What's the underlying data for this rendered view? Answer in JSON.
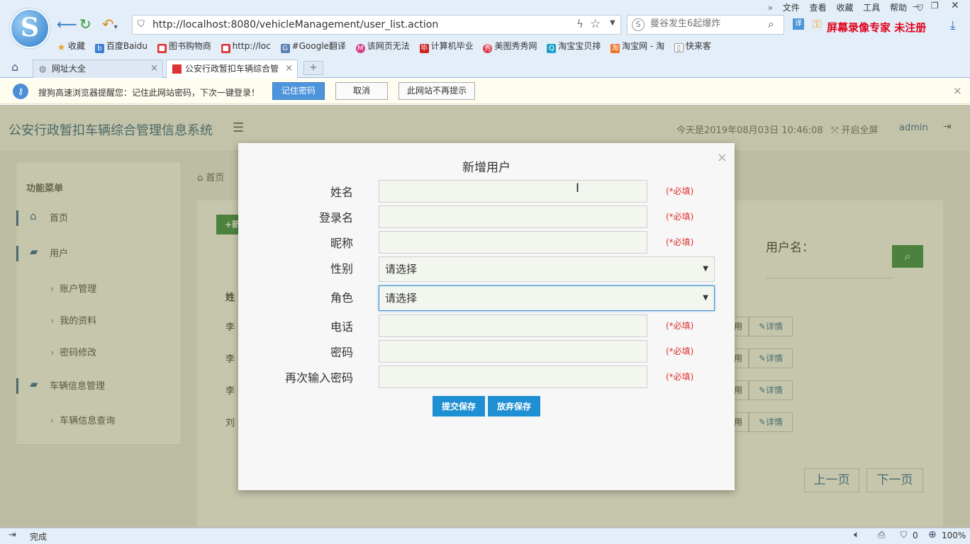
{
  "browser": {
    "url": "http://localhost:8080/vehicleManagement/user_list.action",
    "search_placeholder": "曼谷发生6起爆炸",
    "menu": [
      "文件",
      "查看",
      "收藏",
      "工具",
      "帮助"
    ],
    "recorder_watermark": "屏幕录像专家  未注册",
    "bookmarks": [
      "收藏",
      "百度Baidu",
      "图书购物商",
      "http://loc",
      "#Google翻译",
      "该网页无法",
      "计算机毕业",
      "美图秀秀网",
      "淘宝宝贝排",
      "淘宝网 - 淘",
      "快来客"
    ],
    "tabs": [
      {
        "label": "网址大全",
        "active": false
      },
      {
        "label": "公安行政暂扣车辆综合管",
        "active": true
      }
    ],
    "infobar": {
      "message": "搜狗高速浏览器提醒您：记住此网站密码，下次一键登录！",
      "remember_label": "记住密码",
      "cancel_label": "取消",
      "never_label": "此网站不再提示"
    },
    "status": {
      "text": "完成",
      "count": "0",
      "zoom": "100%"
    }
  },
  "app": {
    "title": "公安行政暂扣车辆综合管理信息系统",
    "date_text": "今天是2019年08月03日 10:46:08",
    "fullscreen_label": "开启全屏",
    "user": "admin",
    "sidebar": {
      "header": "功能菜单",
      "items": [
        {
          "label": "首页",
          "type": "main",
          "icon": "home-icon"
        },
        {
          "label": "用户",
          "type": "main",
          "icon": "folder-icon"
        },
        {
          "label": "账户管理",
          "type": "sub"
        },
        {
          "label": "我的资料",
          "type": "sub"
        },
        {
          "label": "密码修改",
          "type": "sub"
        },
        {
          "label": "车辆信息管理",
          "type": "main",
          "icon": "folder-icon"
        },
        {
          "label": "车辆信息查询",
          "type": "sub"
        }
      ]
    },
    "breadcrumb": "首页",
    "content": {
      "add_button": "+新",
      "username_label": "用户名：",
      "table_col1": "姓",
      "rows": [
        {
          "name": "李",
          "action_cut": "用",
          "detail": "详情"
        },
        {
          "name": "李",
          "action_cut": "用",
          "detail": "详情"
        },
        {
          "name": "李",
          "action_cut": "用",
          "detail": "详情"
        },
        {
          "name": "刘",
          "action_cut": "用",
          "detail": "详情"
        }
      ],
      "prev_label": "上一页",
      "next_label": "下一页"
    }
  },
  "modal": {
    "title": "新增用户",
    "close": "×",
    "fields": [
      {
        "label": "姓名",
        "type": "input",
        "value": "",
        "required": "(*必填)"
      },
      {
        "label": "登录名",
        "type": "input",
        "value": "",
        "required": "(*必填)"
      },
      {
        "label": "昵称",
        "type": "input",
        "value": "",
        "required": "(*必填)"
      },
      {
        "label": "性别",
        "type": "select",
        "value": "请选择",
        "required": ""
      },
      {
        "label": "角色",
        "type": "select",
        "value": "请选择",
        "required": ""
      },
      {
        "label": "电话",
        "type": "input",
        "value": "",
        "required": "(*必填)"
      },
      {
        "label": "密码",
        "type": "input",
        "value": "",
        "required": "(*必填)"
      },
      {
        "label": "再次输入密码",
        "type": "input",
        "value": "",
        "required": "(*必填)"
      }
    ],
    "submit_label": "提交保存",
    "cancel_label": "放弃保存"
  },
  "colors": {
    "accent": "#1e8fd2",
    "brand": "#2a5f86",
    "required": "#e03030",
    "green": "#2e8b3e"
  }
}
